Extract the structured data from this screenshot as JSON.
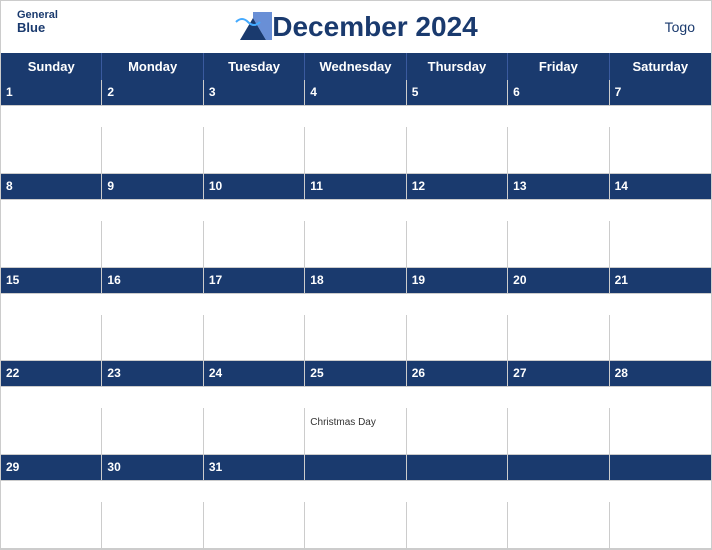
{
  "header": {
    "title": "December 2024",
    "country": "Togo",
    "logo": {
      "line1": "General",
      "line2": "Blue"
    }
  },
  "days_of_week": [
    "Sunday",
    "Monday",
    "Tuesday",
    "Wednesday",
    "Thursday",
    "Friday",
    "Saturday"
  ],
  "weeks": [
    {
      "header_days": [
        "1",
        "2",
        "3",
        "4",
        "5",
        "6",
        "7"
      ],
      "events": [
        {},
        {},
        {},
        {},
        {},
        {},
        {}
      ]
    },
    {
      "header_days": [
        "8",
        "9",
        "10",
        "11",
        "12",
        "13",
        "14"
      ],
      "events": [
        {},
        {},
        {},
        {},
        {},
        {},
        {}
      ]
    },
    {
      "header_days": [
        "15",
        "16",
        "17",
        "18",
        "19",
        "20",
        "21"
      ],
      "events": [
        {},
        {},
        {},
        {},
        {},
        {},
        {}
      ]
    },
    {
      "header_days": [
        "22",
        "23",
        "24",
        "25",
        "26",
        "27",
        "28"
      ],
      "events": [
        {},
        {},
        {},
        {
          "name": "Christmas Day"
        },
        {},
        {},
        {}
      ]
    },
    {
      "header_days": [
        "29",
        "30",
        "31",
        "",
        "",
        "",
        ""
      ],
      "events": [
        {},
        {},
        {},
        {},
        {},
        {},
        {}
      ]
    }
  ],
  "accent_color": "#1a3a6e",
  "event_day_25": "Christmas Day"
}
